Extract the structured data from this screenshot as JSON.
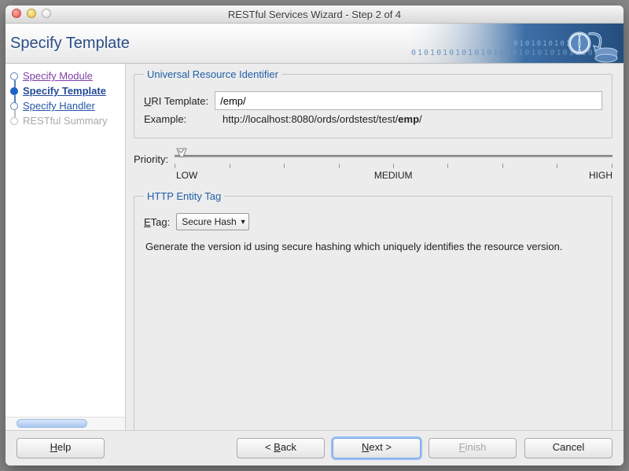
{
  "window": {
    "title": "RESTful Services Wizard - Step 2 of 4"
  },
  "header": {
    "title": "Specify Template"
  },
  "steps": [
    {
      "label": "Specify Module",
      "state": "done"
    },
    {
      "label": "Specify Template",
      "state": "current"
    },
    {
      "label": "Specify Handler",
      "state": "pending"
    },
    {
      "label": "RESTful Summary",
      "state": "disabled"
    }
  ],
  "uri_group": {
    "legend": "Universal Resource Identifier",
    "template_label": "URI Template:",
    "template_value": "/emp/",
    "example_label": "Example:",
    "example_prefix": "http://localhost:8080/ords/ordstest/test/",
    "example_bold": "emp",
    "example_suffix": "/"
  },
  "priority": {
    "label": "Priority:",
    "low": "LOW",
    "medium": "MEDIUM",
    "high": "HIGH",
    "value_index": 0,
    "tick_count": 9
  },
  "etag_group": {
    "legend": "HTTP Entity Tag",
    "label": "ETag:",
    "selected": "Secure Hash",
    "description": "Generate the version id using secure hashing which uniquely identifies the resource version."
  },
  "buttons": {
    "help": "Help",
    "back": "< Back",
    "next": "Next >",
    "finish": "Finish",
    "cancel": "Cancel"
  }
}
